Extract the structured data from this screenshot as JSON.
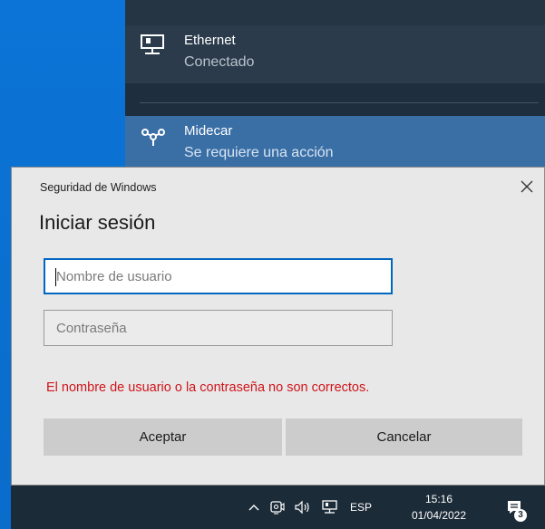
{
  "network_flyout": {
    "ethernet": {
      "name": "Ethernet",
      "status": "Conectado",
      "icon": "ethernet-icon"
    },
    "wifi": {
      "name": "Midecar",
      "status": "Se requiere una acción",
      "icon": "wifi-signal-icon"
    }
  },
  "dialog": {
    "caption": "Seguridad de Windows",
    "heading": "Iniciar sesión",
    "username_placeholder": "Nombre de usuario",
    "password_placeholder": "Contraseña",
    "error_message": "El nombre de usuario o la contraseña no son correctos.",
    "ok_label": "Aceptar",
    "cancel_label": "Cancelar",
    "close_glyph": "✕",
    "error_color": "#d0141a",
    "focus_color": "#0067c0"
  },
  "taskbar": {
    "language": "ESP",
    "time": "15:16",
    "date": "01/04/2022",
    "notification_count": "3",
    "chevron_glyph": "^"
  }
}
